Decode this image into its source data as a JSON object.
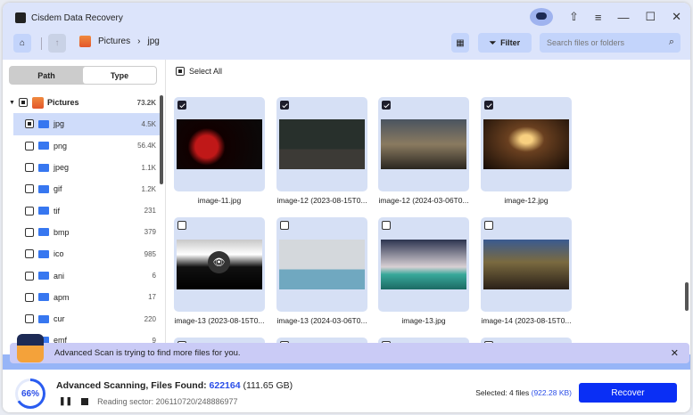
{
  "app": {
    "title": "Cisdem Data Recovery"
  },
  "breadcrumb": {
    "root": "Pictures",
    "current": "jpg"
  },
  "toolbar": {
    "filter": "Filter",
    "search_placeholder": "Search files or folders"
  },
  "sidebar": {
    "tabs": [
      "Path",
      "Type"
    ],
    "active_tab": "Type",
    "root": {
      "label": "Pictures",
      "count": "73.2K"
    },
    "items": [
      {
        "label": "jpg",
        "count": "4.5K"
      },
      {
        "label": "png",
        "count": "56.4K"
      },
      {
        "label": "jpeg",
        "count": "1.1K"
      },
      {
        "label": "gif",
        "count": "1.2K"
      },
      {
        "label": "tif",
        "count": "231"
      },
      {
        "label": "bmp",
        "count": "379"
      },
      {
        "label": "ico",
        "count": "985"
      },
      {
        "label": "ani",
        "count": "6"
      },
      {
        "label": "apm",
        "count": "17"
      },
      {
        "label": "cur",
        "count": "220"
      },
      {
        "label": "emf",
        "count": "9"
      }
    ]
  },
  "grid": {
    "select_all": "Select All",
    "files": [
      {
        "name": "image-11.jpg",
        "checked": true
      },
      {
        "name": "image-12 (2023-08-15T0...",
        "checked": true
      },
      {
        "name": "image-12 (2024-03-06T0...",
        "checked": true
      },
      {
        "name": "image-12.jpg",
        "checked": true
      },
      {
        "name": "image-13 (2023-08-15T0...",
        "checked": false
      },
      {
        "name": "image-13 (2024-03-06T0...",
        "checked": false
      },
      {
        "name": "image-13.jpg",
        "checked": false
      },
      {
        "name": "image-14 (2023-08-15T0...",
        "checked": false
      }
    ]
  },
  "banner": {
    "text": "Advanced Scan is trying to find more files for you."
  },
  "status": {
    "progress_percent": 66,
    "progress_label": "66%",
    "title": "Advanced Scanning, Files Found: ",
    "files_found": "622164",
    "size": "(111.65 GB)",
    "sector": "Reading sector: 206110720/248886977",
    "selected": "Selected: 4 files",
    "selected_size": "(922.28 KB)",
    "recover": "Recover"
  },
  "colors": {
    "accent": "#0a2ff5",
    "header": "#dce4fb"
  }
}
